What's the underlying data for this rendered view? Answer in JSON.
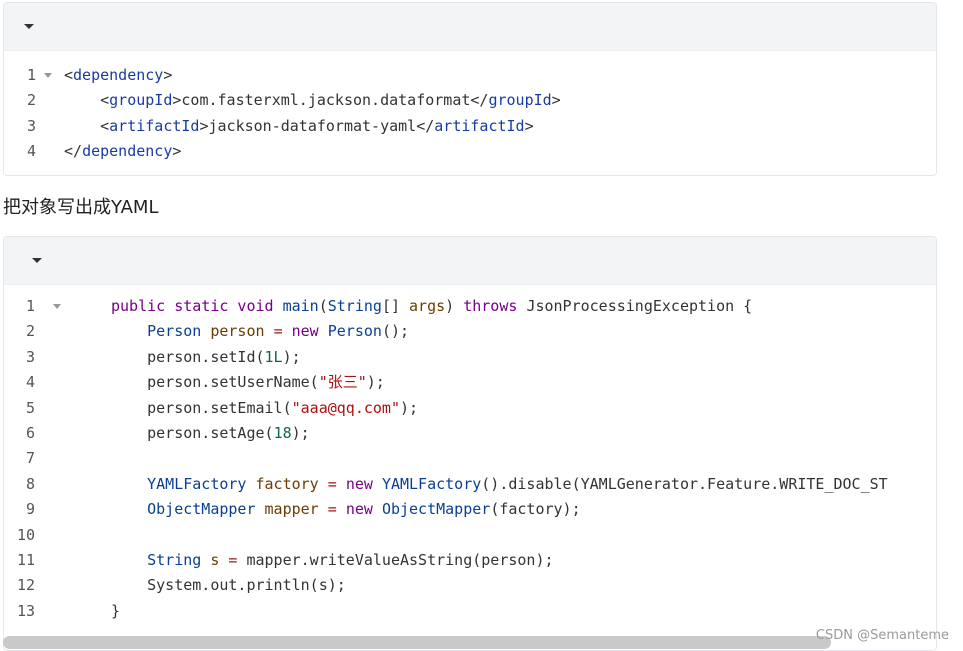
{
  "block1": {
    "lines": [
      {
        "n": "1",
        "parts": [
          [
            "punct",
            "<"
          ],
          [
            "tagname",
            "dependency"
          ],
          [
            "punct",
            ">"
          ]
        ]
      },
      {
        "n": "2",
        "parts": [
          [
            "punct",
            "    <"
          ],
          [
            "tagname",
            "groupId"
          ],
          [
            "punct",
            ">com.fasterxml.jackson.dataformat</"
          ],
          [
            "tagname",
            "groupId"
          ],
          [
            "punct",
            ">"
          ]
        ]
      },
      {
        "n": "3",
        "parts": [
          [
            "punct",
            "    <"
          ],
          [
            "tagname",
            "artifactId"
          ],
          [
            "punct",
            ">jackson-dataformat-yaml</"
          ],
          [
            "tagname",
            "artifactId"
          ],
          [
            "punct",
            ">"
          ]
        ]
      },
      {
        "n": "4",
        "parts": [
          [
            "punct",
            "</"
          ],
          [
            "tagname",
            "dependency"
          ],
          [
            "punct",
            ">"
          ]
        ]
      }
    ]
  },
  "caption": "把对象写出成YAML",
  "block2": {
    "lines": [
      {
        "n": "1",
        "parts": [
          [
            "kw",
            "public static void "
          ],
          [
            "ty",
            "main"
          ],
          [
            "punct",
            "("
          ],
          [
            "ty",
            "String"
          ],
          [
            "punct",
            "[] "
          ],
          [
            "var",
            "args"
          ],
          [
            "punct",
            ") "
          ],
          [
            "kw",
            "throws "
          ],
          [
            "punct",
            "JsonProcessingException {"
          ]
        ]
      },
      {
        "n": "2",
        "parts": [
          [
            "punct",
            "    "
          ],
          [
            "ty",
            "Person "
          ],
          [
            "var",
            "person "
          ],
          [
            "op",
            "= "
          ],
          [
            "kw",
            "new "
          ],
          [
            "ty",
            "Person"
          ],
          [
            "punct",
            "();"
          ]
        ]
      },
      {
        "n": "3",
        "parts": [
          [
            "punct",
            "    person.setId("
          ],
          [
            "num",
            "1L"
          ],
          [
            "punct",
            ");"
          ]
        ]
      },
      {
        "n": "4",
        "parts": [
          [
            "punct",
            "    person.setUserName("
          ],
          [
            "str",
            "\"张三\""
          ],
          [
            "punct",
            ");"
          ]
        ]
      },
      {
        "n": "5",
        "parts": [
          [
            "punct",
            "    person.setEmail("
          ],
          [
            "str",
            "\"aaa@qq.com\""
          ],
          [
            "punct",
            ");"
          ]
        ]
      },
      {
        "n": "6",
        "parts": [
          [
            "punct",
            "    person.setAge("
          ],
          [
            "num",
            "18"
          ],
          [
            "punct",
            ");"
          ]
        ]
      },
      {
        "n": "7",
        "parts": []
      },
      {
        "n": "8",
        "parts": [
          [
            "punct",
            "    "
          ],
          [
            "ty",
            "YAMLFactory "
          ],
          [
            "var",
            "factory "
          ],
          [
            "op",
            "= "
          ],
          [
            "kw",
            "new "
          ],
          [
            "ty",
            "YAMLFactory"
          ],
          [
            "punct",
            "().disable(YAMLGenerator.Feature.WRITE_DOC_ST"
          ]
        ]
      },
      {
        "n": "9",
        "parts": [
          [
            "punct",
            "    "
          ],
          [
            "ty",
            "ObjectMapper "
          ],
          [
            "var",
            "mapper "
          ],
          [
            "op",
            "= "
          ],
          [
            "kw",
            "new "
          ],
          [
            "ty",
            "ObjectMapper"
          ],
          [
            "punct",
            "(factory);"
          ]
        ]
      },
      {
        "n": "10",
        "parts": []
      },
      {
        "n": "11",
        "parts": [
          [
            "punct",
            "    "
          ],
          [
            "ty",
            "String "
          ],
          [
            "var",
            "s "
          ],
          [
            "op",
            "= "
          ],
          [
            "punct",
            "mapper.writeValueAsString(person);"
          ]
        ]
      },
      {
        "n": "12",
        "parts": [
          [
            "punct",
            "    System.out.println(s);"
          ]
        ]
      },
      {
        "n": "13",
        "parts": [
          [
            "punct",
            "}"
          ]
        ]
      }
    ]
  },
  "watermark": "CSDN @Semanteme"
}
